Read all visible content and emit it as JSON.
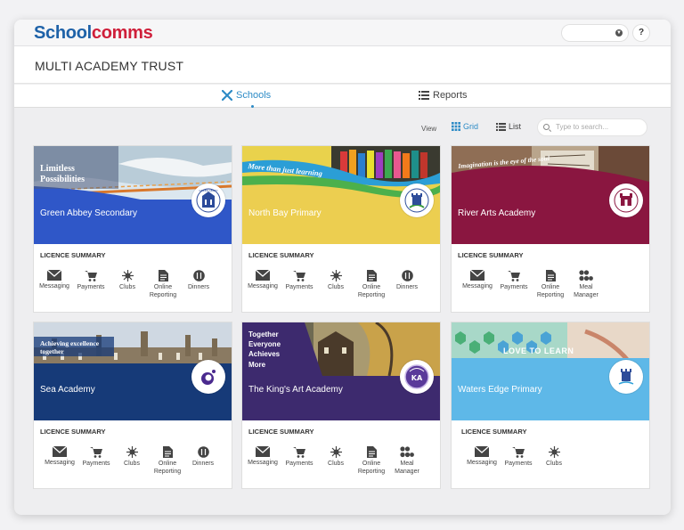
{
  "app": {
    "logo_part1": "School",
    "logo_part2": "comms",
    "help": "?"
  },
  "org": {
    "title": "MULTI ACADEMY TRUST"
  },
  "tabs": {
    "schools": "Schools",
    "reports": "Reports"
  },
  "view": {
    "label": "View",
    "grid": "Grid",
    "list": "List",
    "search_placeholder": "Type to search..."
  },
  "colors": {
    "brand_blue": "#1e62a8",
    "brand_red": "#cf1f3a",
    "accent": "#2d8bc6"
  },
  "licence_label": "LICENCE SUMMARY",
  "cards": [
    {
      "name": "Green Abbey Secondary",
      "tagline": "Limitless Possibilities",
      "crest": "GREEN ABBEY",
      "color": "#2f57c8",
      "modules": [
        "Messaging",
        "Payments",
        "Clubs",
        "Online Reporting",
        "Dinners"
      ]
    },
    {
      "name": "North Bay Primary",
      "tagline": "More than just learning",
      "color": "#ecce50",
      "modules": [
        "Messaging",
        "Payments",
        "Clubs",
        "Online Reporting",
        "Dinners"
      ]
    },
    {
      "name": "River Arts Academy",
      "tagline": "Imagination is the eye of the soul",
      "color": "#8a1640",
      "modules": [
        "Messaging",
        "Payments",
        "Online Reporting",
        "Meal Manager"
      ]
    },
    {
      "name": "Sea Academy",
      "tagline": "Achieving excellence together",
      "color": "#163a78",
      "modules": [
        "Messaging",
        "Payments",
        "Clubs",
        "Online Reporting",
        "Dinners"
      ]
    },
    {
      "name": "The King's Art Academy",
      "tagline": "Together Everyone Achieves More",
      "crest": "KA",
      "color": "#3d2a6e",
      "modules": [
        "Messaging",
        "Payments",
        "Clubs",
        "Online Reporting",
        "Meal Manager"
      ]
    },
    {
      "name": "Waters Edge Primary",
      "tagline": "LOVE TO LEARN",
      "color": "#5eb8e8",
      "modules": [
        "Messaging",
        "Payments",
        "Clubs"
      ]
    }
  ]
}
